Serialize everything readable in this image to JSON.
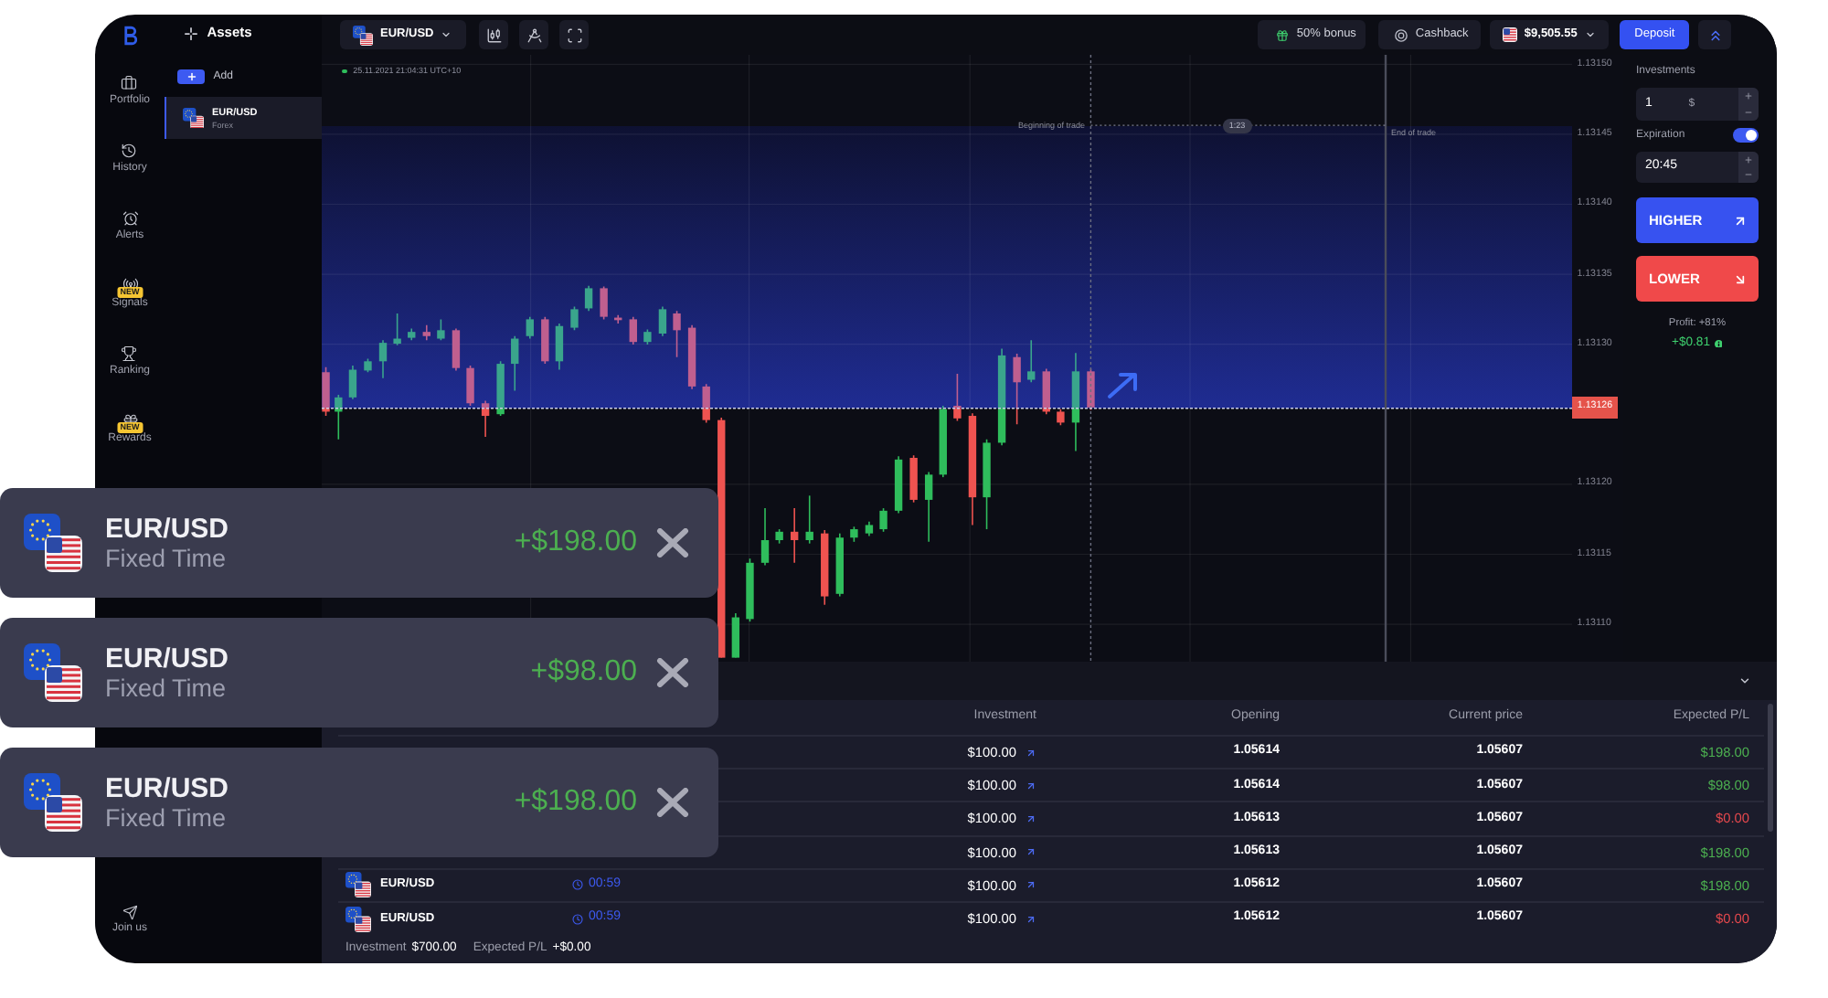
{
  "nav": {
    "items": [
      {
        "label": "Portfolio"
      },
      {
        "label": "History"
      },
      {
        "label": "Alerts"
      },
      {
        "label": "Signals",
        "badge": "NEW"
      },
      {
        "label": "Ranking"
      },
      {
        "label": "Rewards",
        "badge": "NEW"
      }
    ],
    "footer": "Join us"
  },
  "assets_panel": {
    "title": "Assets",
    "add_label": "Add",
    "items": [
      {
        "name": "EUR/USD",
        "category": "Forex",
        "selected": true
      }
    ]
  },
  "toolbar": {
    "asset": "EUR/USD",
    "bonus": "50% bonus",
    "cashback": "Cashback",
    "balance": "$9,505.55",
    "deposit": "Deposit"
  },
  "chart": {
    "timestamp": "25.11.2021 21:04:31 UTC+10",
    "trade_start_label": "Beginning of trade",
    "timer": "1:23",
    "trade_end_label": "End of trade",
    "price_axis": [
      {
        "label": "1.13150",
        "kind": "tick"
      },
      {
        "label": "1.13145",
        "kind": "tick"
      },
      {
        "label": "1.13140",
        "kind": "tick"
      },
      {
        "label": "1.13135",
        "kind": "tick"
      },
      {
        "label": "1.13130",
        "kind": "tick"
      },
      {
        "label": "1.13126",
        "kind": "current"
      },
      {
        "label": "1.13120",
        "kind": "tick"
      },
      {
        "label": "1.13115",
        "kind": "tick"
      },
      {
        "label": "1.13110",
        "kind": "tick"
      }
    ]
  },
  "trade_panel": {
    "investment_label": "Investments",
    "investment": "1",
    "currency": "$",
    "expiration_label": "Expiration",
    "expiration_on": true,
    "expiration": "20:45",
    "higher": "HIGHER",
    "lower": "LOWER",
    "profit": "Profit: +81%",
    "payout": "+$0.81"
  },
  "positions": {
    "columns": [
      "Investment",
      "Opening",
      "Current price",
      "Expected P/L"
    ],
    "rows": [
      {
        "investment": "$100.00",
        "opening": "1.05614",
        "current": "1.05607",
        "pl": "$198.00",
        "color": "#4caf50"
      },
      {
        "investment": "$100.00",
        "opening": "1.05614",
        "current": "1.05607",
        "pl": "$98.00",
        "color": "#4caf50"
      },
      {
        "investment": "$100.00",
        "opening": "1.05613",
        "current": "1.05607",
        "pl": "$0.00",
        "color": "#e5484d"
      },
      {
        "investment": "$100.00",
        "opening": "1.05613",
        "current": "1.05607",
        "pl": "$198.00",
        "color": "#4caf50"
      },
      {
        "asset": "EUR/USD",
        "time": "00:59",
        "investment": "$100.00",
        "opening": "1.05612",
        "current": "1.05607",
        "pl": "$198.00",
        "color": "#4caf50"
      },
      {
        "asset": "EUR/USD",
        "time": "00:59",
        "investment": "$100.00",
        "opening": "1.05612",
        "current": "1.05607",
        "pl": "$0.00",
        "color": "#e5484d"
      }
    ],
    "footer": {
      "investment_label": "Investment",
      "investment": "$700.00",
      "pl_label": "Expected P/L",
      "pl": "+$0.00"
    }
  },
  "notifications": [
    {
      "pair": "EUR/USD",
      "type": "Fixed Time",
      "amount": "+$198.00"
    },
    {
      "pair": "EUR/USD",
      "type": "Fixed Time",
      "amount": "+$98.00"
    },
    {
      "pair": "EUR/USD",
      "type": "Fixed Time",
      "amount": "+$198.00"
    }
  ]
}
